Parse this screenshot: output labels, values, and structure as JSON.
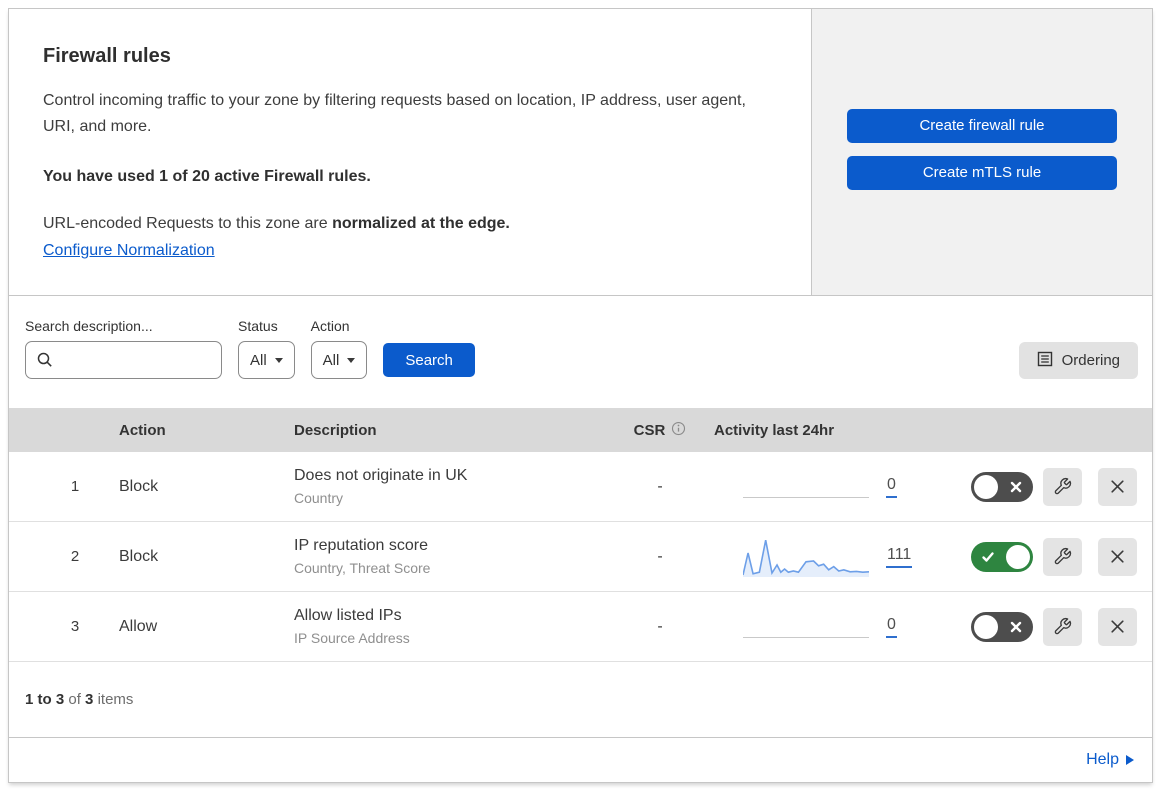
{
  "intro": {
    "title": "Firewall rules",
    "description": "Control incoming traffic to your zone by filtering requests based on location, IP address, user agent, URI, and more.",
    "usage": "You have used 1 of 20 active Firewall rules.",
    "normalization_prefix": "URL-encoded Requests to this zone are ",
    "normalization_emphasis": "normalized at the edge.",
    "normalization_link": "Configure Normalization"
  },
  "actions": {
    "create_firewall_rule": "Create firewall rule",
    "create_mtls_rule": "Create mTLS rule"
  },
  "filters": {
    "search_label": "Search description...",
    "search_value": "",
    "status_label": "Status",
    "status_value": "All",
    "action_label": "Action",
    "action_value": "All",
    "search_button": "Search",
    "ordering_button": "Ordering"
  },
  "table": {
    "columns": {
      "action": "Action",
      "description": "Description",
      "csr": "CSR",
      "activity": "Activity last 24hr"
    },
    "rows": [
      {
        "priority": "1",
        "action": "Block",
        "description": "Does not originate in UK",
        "criteria": "Country",
        "csr": "-",
        "activity_count": "0",
        "enabled": false,
        "sparkline": null
      },
      {
        "priority": "2",
        "action": "Block",
        "description": "IP reputation score",
        "criteria": "Country, Threat Score",
        "csr": "-",
        "activity_count": "111",
        "enabled": true,
        "sparkline": [
          [
            0,
            95
          ],
          [
            4,
            40
          ],
          [
            8,
            92
          ],
          [
            13,
            88
          ],
          [
            18,
            8
          ],
          [
            23,
            90
          ],
          [
            27,
            70
          ],
          [
            30,
            88
          ],
          [
            33,
            80
          ],
          [
            36,
            88
          ],
          [
            40,
            85
          ],
          [
            44,
            88
          ],
          [
            50,
            62
          ],
          [
            56,
            60
          ],
          [
            60,
            72
          ],
          [
            64,
            68
          ],
          [
            68,
            82
          ],
          [
            72,
            74
          ],
          [
            76,
            85
          ],
          [
            80,
            82
          ],
          [
            85,
            87
          ],
          [
            90,
            86
          ],
          [
            95,
            88
          ],
          [
            100,
            87
          ]
        ]
      },
      {
        "priority": "3",
        "action": "Allow",
        "description": "Allow listed IPs",
        "criteria": "IP Source Address",
        "csr": "-",
        "activity_count": "0",
        "enabled": false,
        "sparkline": null
      }
    ]
  },
  "pager": {
    "range": "1 to 3",
    "of": "of",
    "total": "3",
    "items": "items"
  },
  "help": {
    "label": "Help"
  },
  "colors": {
    "accent_blue": "#0b5bcc",
    "toggle_on_green": "#2e8540",
    "toggle_off_gray": "#4d4d4d",
    "header_band_gray": "#d9d9d9",
    "cta_panel_gray": "#f1f1f1",
    "sparkline_blue": "#6d9fe8"
  }
}
